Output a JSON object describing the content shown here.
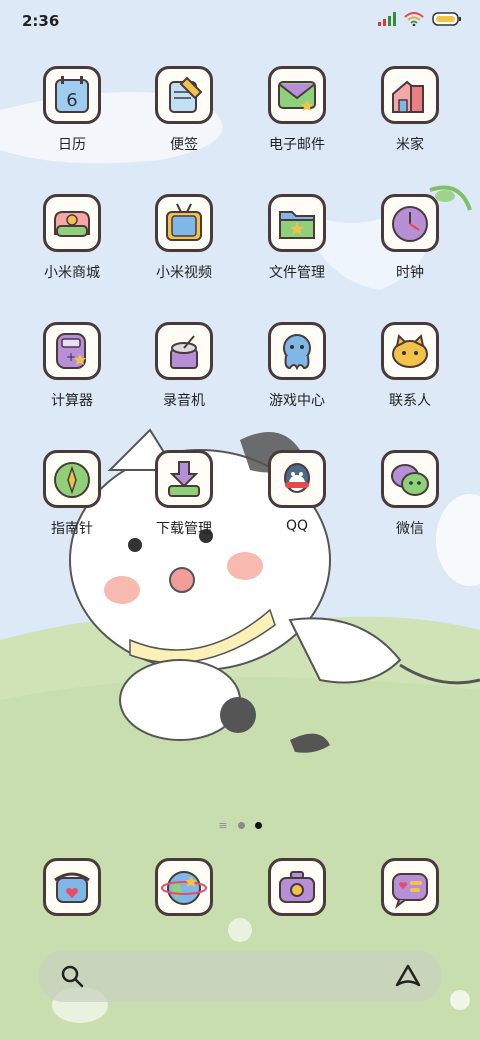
{
  "status_bar": {
    "time": "2:36"
  },
  "apps": [
    {
      "label": "日历",
      "icon": "calendar-icon",
      "badge": "6"
    },
    {
      "label": "便签",
      "icon": "notes-icon"
    },
    {
      "label": "电子邮件",
      "icon": "email-icon"
    },
    {
      "label": "米家",
      "icon": "smart-home-icon"
    },
    {
      "label": "小米商城",
      "icon": "shop-icon"
    },
    {
      "label": "小米视频",
      "icon": "tv-icon"
    },
    {
      "label": "文件管理",
      "icon": "folder-icon"
    },
    {
      "label": "时钟",
      "icon": "clock-icon"
    },
    {
      "label": "计算器",
      "icon": "calculator-icon"
    },
    {
      "label": "录音机",
      "icon": "recorder-icon"
    },
    {
      "label": "游戏中心",
      "icon": "game-icon"
    },
    {
      "label": "联系人",
      "icon": "contacts-icon"
    },
    {
      "label": "指南针",
      "icon": "compass-icon"
    },
    {
      "label": "下载管理",
      "icon": "download-icon"
    },
    {
      "label": "QQ",
      "icon": "qq-icon"
    },
    {
      "label": "微信",
      "icon": "wechat-icon"
    }
  ],
  "dock": [
    {
      "icon": "phone-icon"
    },
    {
      "icon": "browser-icon"
    },
    {
      "icon": "camera-icon"
    },
    {
      "icon": "messages-icon"
    }
  ],
  "page_indicator": {
    "pages": 2,
    "active": 2
  },
  "search_bar": {
    "icon": "search-icon",
    "assistant_icon": "assistant-icon"
  }
}
